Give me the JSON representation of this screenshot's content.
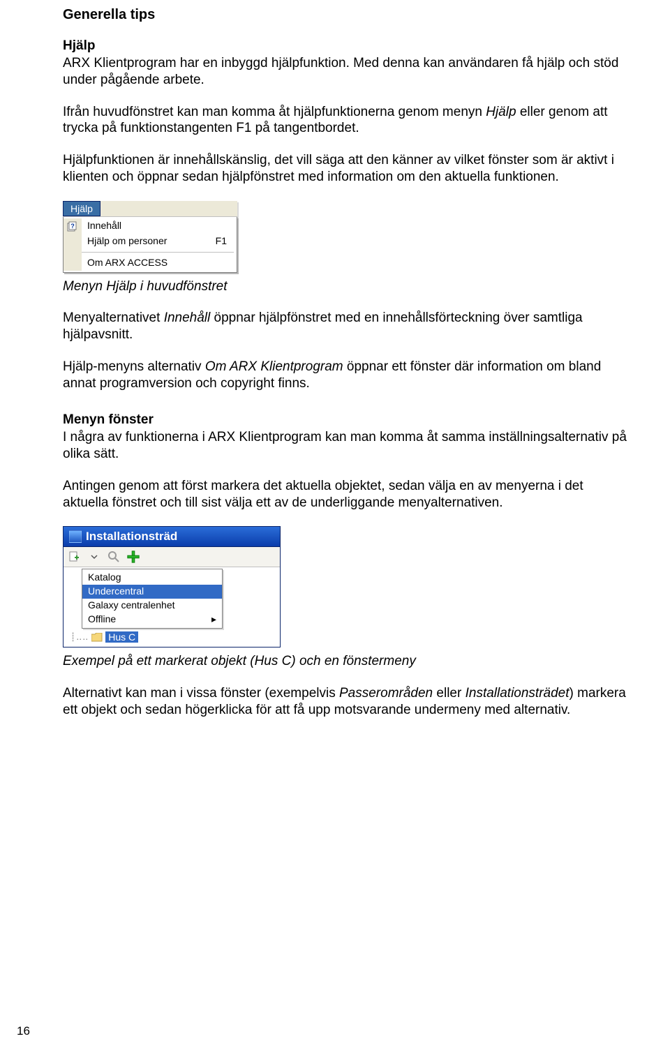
{
  "page_number": "16",
  "section_title": "Generella tips",
  "help": {
    "heading": "Hjälp",
    "p1": "ARX Klientprogram har en inbyggd hjälpfunktion. Med denna kan användaren få hjälp och stöd under pågående arbete.",
    "p2_a": "Ifrån huvudfönstret kan man komma åt hjälpfunktionerna genom menyn ",
    "p2_em": "Hjälp",
    "p2_b": " eller genom att trycka på funktionstangenten F1 på tangentbordet.",
    "p3": "Hjälpfunktionen är innehållskänslig, det vill säga att den känner av vilket fönster som är aktivt i klienten och öppnar sedan hjälpfönstret med information om den aktuella funktionen.",
    "menu": {
      "open_label": "Hjälp",
      "items": [
        {
          "label": "Innehåll",
          "shortcut": ""
        },
        {
          "label": "Hjälp om personer",
          "shortcut": "F1"
        }
      ],
      "about_label": "Om ARX ACCESS"
    },
    "caption": "Menyn Hjälp i huvudfönstret",
    "p4_a": "Menyalternativet ",
    "p4_em": "Innehåll",
    "p4_b": " öppnar hjälpfönstret med en innehållsförteckning över samtliga hjälpavsnitt.",
    "p5_a": "Hjälp-menyns alternativ ",
    "p5_em": "Om ARX Klientprogram",
    "p5_b": " öppnar ett fönster där information om bland annat programversion och copyright finns."
  },
  "window_menu": {
    "heading": "Menyn fönster",
    "p1": "I några av funktionerna i ARX Klientprogram kan man komma åt samma inställningsalternativ på olika sätt.",
    "p2": "Antingen genom att först markera det aktuella objektet, sedan välja en av menyerna i det aktuella fönstret och till sist välja ett av de underliggande menyalternativen.",
    "window": {
      "title": "Installationsträd",
      "context_items": [
        {
          "label": "Katalog",
          "selected": false,
          "submenu": false
        },
        {
          "label": "Undercentral",
          "selected": true,
          "submenu": false
        },
        {
          "label": "Galaxy centralenhet",
          "selected": false,
          "submenu": false
        },
        {
          "label": "Offline",
          "selected": false,
          "submenu": true
        }
      ],
      "tree_selected": "Hus C"
    },
    "caption": "Exempel på ett markerat objekt (Hus C) och en fönstermeny",
    "p3_a": "Alternativt kan man i vissa fönster (exempelvis ",
    "p3_em1": "Passerområden",
    "p3_mid": " eller ",
    "p3_em2": "Installationsträdet",
    "p3_b": ") markera ett objekt och sedan högerklicka för att få upp motsvarande undermeny med alternativ."
  }
}
